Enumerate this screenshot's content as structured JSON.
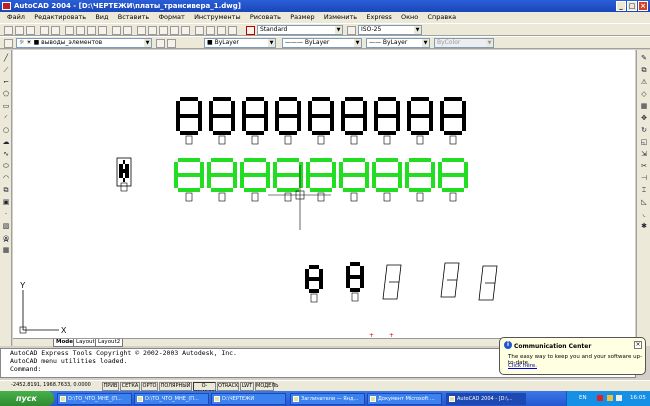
{
  "window": {
    "title": "AutoCAD 2004 - [D:\\ЧЕРТЕЖИ\\платы_трансивера_1.dwg]"
  },
  "menu": [
    "Файл",
    "Редактировать",
    "Вид",
    "Вставить",
    "Формат",
    "Инструменты",
    "Рисовать",
    "Размер",
    "Изменить",
    "Express",
    "Окно",
    "Справка"
  ],
  "styles": {
    "text_style": "Standard",
    "dim_style": "ISO-25"
  },
  "layers": {
    "current": "выводы_элементов",
    "color": "ByLayer",
    "linetype": "ByLayer",
    "lineweight": "ByLayer",
    "plotstyle": "ByColor"
  },
  "tabs": [
    "Model",
    "Layout1",
    "Layout2"
  ],
  "ucs": {
    "x": "X",
    "y": "Y"
  },
  "command_lines": [
    "AutoCAD Express Tools Copyright © 2002-2003 Autodesk, Inc.",
    "AutoCAD menu utilities loaded.",
    "Command:"
  ],
  "status": {
    "coords": "-2452.8191, 1968.7633, 0.0000",
    "toggles": [
      "ПРИВ",
      "СЕТКА",
      "ОРТО",
      "ПОЛЯРНЫЙ",
      "О-ПРИВЯЗКА",
      "OTRACK",
      "LWT",
      "МОДЕЛЬ"
    ]
  },
  "popup": {
    "title": "Communication Center",
    "body": "The easy way to keep you and your software up-to-date.",
    "link": "Click here."
  },
  "taskbar": {
    "start": "пуск",
    "items": [
      "D:\\ТО_ЧТО_МНЕ_(П...",
      "D:\\ТО_ЧТО_МНЕ_(П...",
      "D:\\ЧЕРТЕЖИ",
      "Заглинатели — Янд...",
      "Документ Microsoft ...",
      "AutoCAD 2004 - [D:\\..."
    ],
    "lang": "EN",
    "clock": "16:05"
  },
  "colors": {
    "digit_black": "#000000",
    "digit_green": "#22dd22"
  }
}
